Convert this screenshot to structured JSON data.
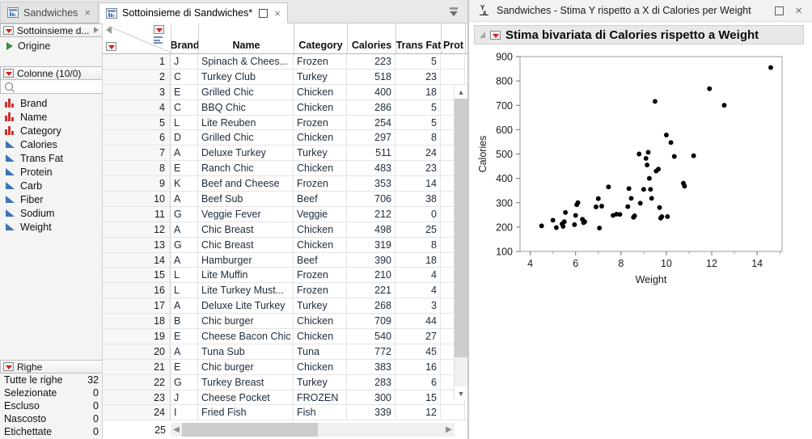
{
  "tabs": [
    {
      "label": "Sandwiches",
      "icon": "jmp-table-icon",
      "active": false,
      "close": "×"
    },
    {
      "label": "Sottoinsieme di Sandwiches*",
      "icon": "jmp-table-icon",
      "active": true,
      "close": "×"
    }
  ],
  "sidebar": {
    "table_panel": {
      "title": "Sottoinsieme d...",
      "items": [
        {
          "label": "Origine",
          "icon": "green-play-icon"
        }
      ]
    },
    "columns_panel": {
      "title": "Colonne (10/0)",
      "search_placeholder": "",
      "items": [
        {
          "label": "Brand",
          "type": "nominal"
        },
        {
          "label": "Name",
          "type": "nominal"
        },
        {
          "label": "Category",
          "type": "nominal"
        },
        {
          "label": "Calories",
          "type": "continuous"
        },
        {
          "label": "Trans Fat",
          "type": "continuous"
        },
        {
          "label": "Protein",
          "type": "continuous"
        },
        {
          "label": "Carb",
          "type": "continuous"
        },
        {
          "label": "Fiber",
          "type": "continuous"
        },
        {
          "label": "Sodium",
          "type": "continuous"
        },
        {
          "label": "Weight",
          "type": "continuous"
        }
      ]
    },
    "rows_panel": {
      "title": "Righe",
      "stats": [
        {
          "label": "Tutte le righe",
          "value": "32"
        },
        {
          "label": "Selezionate",
          "value": "0"
        },
        {
          "label": "Escluso",
          "value": "0"
        },
        {
          "label": "Nascosto",
          "value": "0"
        },
        {
          "label": "Etichettate",
          "value": "0"
        }
      ]
    }
  },
  "grid": {
    "columns": [
      "Brand",
      "Name",
      "Category",
      "Calories",
      "Trans Fat",
      "Prot"
    ],
    "rows": [
      {
        "n": "1",
        "brand": "J",
        "name": "Spinach & Chees...",
        "cat": "Frozen",
        "cal": "223",
        "tf": "5"
      },
      {
        "n": "2",
        "brand": "C",
        "name": "Turkey Club",
        "cat": "Turkey",
        "cal": "518",
        "tf": "23"
      },
      {
        "n": "3",
        "brand": "E",
        "name": "Grilled Chic",
        "cat": "Chicken",
        "cal": "400",
        "tf": "18"
      },
      {
        "n": "4",
        "brand": "C",
        "name": "BBQ Chic",
        "cat": "Chicken",
        "cal": "286",
        "tf": "5"
      },
      {
        "n": "5",
        "brand": "L",
        "name": "Lite Reuben",
        "cat": "Frozen",
        "cal": "254",
        "tf": "5"
      },
      {
        "n": "6",
        "brand": "D",
        "name": "Grilled Chic",
        "cat": "Chicken",
        "cal": "297",
        "tf": "8"
      },
      {
        "n": "7",
        "brand": "A",
        "name": "Deluxe Turkey",
        "cat": "Turkey",
        "cal": "511",
        "tf": "24"
      },
      {
        "n": "8",
        "brand": "E",
        "name": "Ranch Chic",
        "cat": "Chicken",
        "cal": "483",
        "tf": "23"
      },
      {
        "n": "9",
        "brand": "K",
        "name": "Beef and Cheese",
        "cat": "Frozen",
        "cal": "353",
        "tf": "14"
      },
      {
        "n": "10",
        "brand": "A",
        "name": "Beef Sub",
        "cat": "Beef",
        "cal": "706",
        "tf": "38"
      },
      {
        "n": "11",
        "brand": "G",
        "name": "Veggie Fever",
        "cat": "Veggie",
        "cal": "212",
        "tf": "0"
      },
      {
        "n": "12",
        "brand": "A",
        "name": "Chic Breast",
        "cat": "Chicken",
        "cal": "498",
        "tf": "25"
      },
      {
        "n": "13",
        "brand": "G",
        "name": "Chic Breast",
        "cat": "Chicken",
        "cal": "319",
        "tf": "8"
      },
      {
        "n": "14",
        "brand": "A",
        "name": "Hamburger",
        "cat": "Beef",
        "cal": "390",
        "tf": "18"
      },
      {
        "n": "15",
        "brand": "L",
        "name": "Lite Muffin",
        "cat": "Frozen",
        "cal": "210",
        "tf": "4"
      },
      {
        "n": "16",
        "brand": "L",
        "name": "Lite Turkey Must...",
        "cat": "Frozen",
        "cal": "221",
        "tf": "4"
      },
      {
        "n": "17",
        "brand": "A",
        "name": "Deluxe Lite Turkey",
        "cat": "Turkey",
        "cal": "268",
        "tf": "3"
      },
      {
        "n": "18",
        "brand": "B",
        "name": "Chic burger",
        "cat": "Chicken",
        "cal": "709",
        "tf": "44"
      },
      {
        "n": "19",
        "brand": "E",
        "name": "Cheese Bacon Chic",
        "cat": "Chicken",
        "cal": "540",
        "tf": "27"
      },
      {
        "n": "20",
        "brand": "A",
        "name": "Tuna Sub",
        "cat": "Tuna",
        "cal": "772",
        "tf": "45"
      },
      {
        "n": "21",
        "brand": "E",
        "name": "Chic burger",
        "cat": "Chicken",
        "cal": "383",
        "tf": "16"
      },
      {
        "n": "22",
        "brand": "G",
        "name": "Turkey Breast",
        "cat": "Turkey",
        "cal": "283",
        "tf": "6"
      },
      {
        "n": "23",
        "brand": "J",
        "name": "Cheese Pocket",
        "cat": "FROZEN",
        "cal": "300",
        "tf": "15"
      },
      {
        "n": "24",
        "brand": "I",
        "name": "Fried Fish",
        "cat": "Fish",
        "cal": "339",
        "tf": "12"
      }
    ],
    "last_row_number": "25"
  },
  "report": {
    "window_title": "Sandwiches - Stima Y rispetto a X di Calories per Weight",
    "window_icon": "y-by-x-icon",
    "maximize_label": "□",
    "close_label": "×",
    "section_title": "Stima bivariata di Calories rispetto a Weight"
  },
  "chart_data": {
    "type": "scatter",
    "title": "Stima bivariata di Calories rispetto a Weight",
    "xlabel": "Weight",
    "ylabel": "Calories",
    "xlim": [
      3.55,
      15.1
    ],
    "ylim": [
      100,
      900
    ],
    "xticks": [
      4,
      6,
      8,
      10,
      12,
      14
    ],
    "yticks": [
      100,
      200,
      300,
      400,
      500,
      600,
      700,
      800,
      900
    ],
    "xminor": [
      5,
      7,
      9,
      11,
      13,
      15
    ],
    "grid": false,
    "legend": null,
    "marker": {
      "shape": "circle",
      "color": "#000000",
      "size": 4
    },
    "points": [
      {
        "x": 4.5,
        "y": 205
      },
      {
        "x": 5.0,
        "y": 228
      },
      {
        "x": 5.15,
        "y": 198
      },
      {
        "x": 5.4,
        "y": 213
      },
      {
        "x": 5.45,
        "y": 203
      },
      {
        "x": 5.5,
        "y": 222
      },
      {
        "x": 5.55,
        "y": 260
      },
      {
        "x": 5.95,
        "y": 210
      },
      {
        "x": 6.0,
        "y": 248
      },
      {
        "x": 6.05,
        "y": 292
      },
      {
        "x": 6.1,
        "y": 300
      },
      {
        "x": 6.3,
        "y": 232
      },
      {
        "x": 6.35,
        "y": 218
      },
      {
        "x": 6.4,
        "y": 222
      },
      {
        "x": 6.9,
        "y": 283
      },
      {
        "x": 7.0,
        "y": 317
      },
      {
        "x": 7.05,
        "y": 196
      },
      {
        "x": 7.15,
        "y": 286
      },
      {
        "x": 7.45,
        "y": 365
      },
      {
        "x": 7.65,
        "y": 248
      },
      {
        "x": 7.8,
        "y": 253
      },
      {
        "x": 7.95,
        "y": 252
      },
      {
        "x": 8.3,
        "y": 284
      },
      {
        "x": 8.35,
        "y": 358
      },
      {
        "x": 8.45,
        "y": 318
      },
      {
        "x": 8.55,
        "y": 240
      },
      {
        "x": 8.6,
        "y": 246
      },
      {
        "x": 8.8,
        "y": 500
      },
      {
        "x": 8.85,
        "y": 298
      },
      {
        "x": 9.0,
        "y": 355
      },
      {
        "x": 9.1,
        "y": 482
      },
      {
        "x": 9.15,
        "y": 455
      },
      {
        "x": 9.2,
        "y": 507
      },
      {
        "x": 9.25,
        "y": 400
      },
      {
        "x": 9.3,
        "y": 355
      },
      {
        "x": 9.35,
        "y": 318
      },
      {
        "x": 9.5,
        "y": 716
      },
      {
        "x": 9.55,
        "y": 430
      },
      {
        "x": 9.65,
        "y": 438
      },
      {
        "x": 9.7,
        "y": 280
      },
      {
        "x": 9.75,
        "y": 237
      },
      {
        "x": 9.8,
        "y": 243
      },
      {
        "x": 10.0,
        "y": 578
      },
      {
        "x": 10.05,
        "y": 243
      },
      {
        "x": 10.2,
        "y": 547
      },
      {
        "x": 10.35,
        "y": 490
      },
      {
        "x": 10.75,
        "y": 380
      },
      {
        "x": 10.8,
        "y": 368
      },
      {
        "x": 11.2,
        "y": 493
      },
      {
        "x": 11.9,
        "y": 768
      },
      {
        "x": 12.55,
        "y": 700
      },
      {
        "x": 14.6,
        "y": 855
      }
    ]
  }
}
